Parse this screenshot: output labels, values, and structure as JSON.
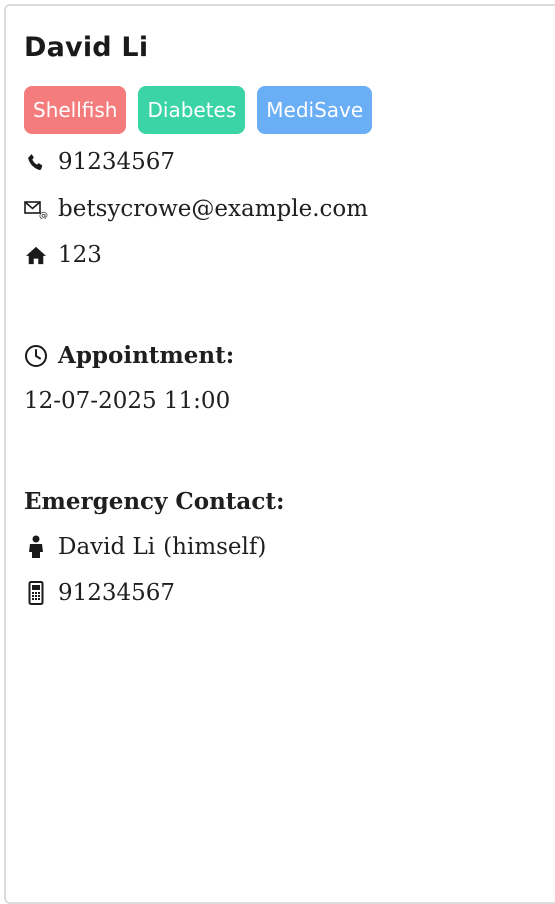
{
  "patient": {
    "name": "David Li",
    "tags": [
      {
        "label": "Shellfish",
        "color": "#f57c7c"
      },
      {
        "label": "Diabetes",
        "color": "#3bd4a6"
      },
      {
        "label": "MediSave",
        "color": "#6aaef5"
      }
    ],
    "phone": "91234567",
    "email": "betsycrowe@example.com",
    "address": "123"
  },
  "appointment": {
    "heading": "Appointment:",
    "datetime": "12-07-2025 11:00"
  },
  "emergency_contact": {
    "heading": "Emergency Contact:",
    "name": "David Li",
    "relationship": "(himself)",
    "phone": "91234567"
  },
  "icons": {
    "phone": "phone-icon",
    "email": "email-icon",
    "address": "home-icon",
    "appointment": "clock-icon",
    "contact_person": "person-icon",
    "contact_phone": "mobile-phone-icon"
  }
}
